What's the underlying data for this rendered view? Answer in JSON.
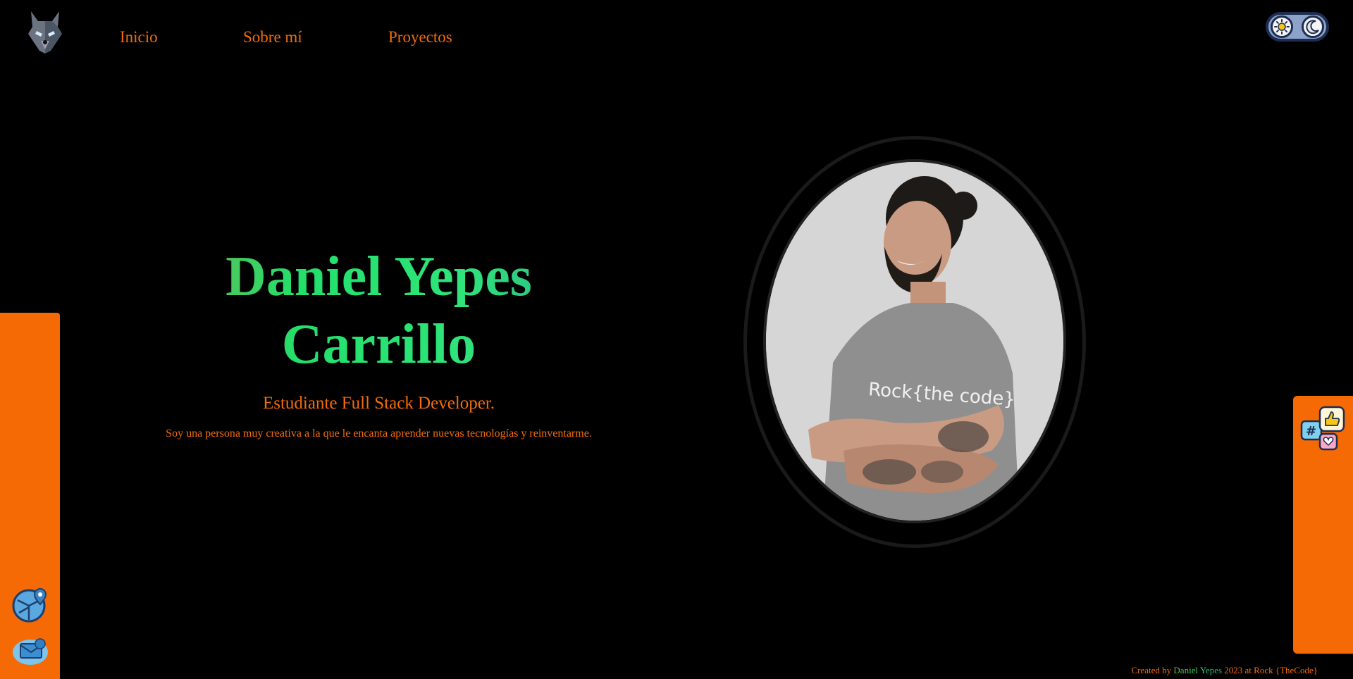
{
  "nav": {
    "items": [
      "Inicio",
      "Sobre mí",
      "Proyectos"
    ]
  },
  "hero": {
    "name_line1": "Daniel Yepes",
    "name_line2": "Carrillo",
    "role": "Estudiante Full Stack Developer.",
    "bio": "Soy una persona muy creativa a la que le encanta aprender nuevas tecnologías y reinventarme.",
    "portrait_shirt_text": "Rock{the code}"
  },
  "footer": {
    "prefix": "Created by",
    "author": "Daniel Yepes",
    "suffix": "2023 at Rock {TheCode}"
  },
  "icons": {
    "logo": "wolf-logo-icon",
    "theme_light": "sun-icon",
    "theme_dark": "moon-icon",
    "location": "map-location-icon",
    "mail": "mail-icon",
    "social": "social-media-icon"
  },
  "colors": {
    "background": "#000000",
    "accent": "#f36c0a",
    "side_bar": "#f56a04",
    "name_gradient_start": "#86a44c",
    "name_gradient_mid": "#22e06a",
    "name_gradient_end": "#2aa58e"
  }
}
